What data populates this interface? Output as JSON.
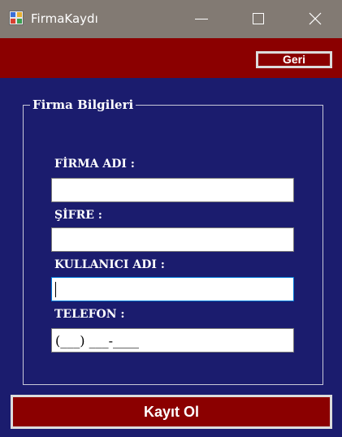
{
  "window": {
    "title": "FirmaKaydı",
    "icon": "app-window-icon",
    "controls": [
      "minimize-icon",
      "maximize-icon",
      "close-icon"
    ]
  },
  "toolbar": {
    "back_label": "Geri"
  },
  "form": {
    "group_title": "Firma Bilgileri",
    "fields": [
      {
        "label": "FİRMA ADI :",
        "value": ""
      },
      {
        "label": "ŞİFRE :",
        "value": ""
      },
      {
        "label": "KULLANICI ADI :",
        "value": "",
        "focused": true
      },
      {
        "label": "TELEFON :",
        "value": "(___) ___-____"
      }
    ],
    "submit_label": "Kayıt Ol"
  },
  "colors": {
    "background": "#1b1c6e",
    "accent": "#8b0000",
    "titlebar": "#827a73",
    "text": "#ffffff"
  }
}
